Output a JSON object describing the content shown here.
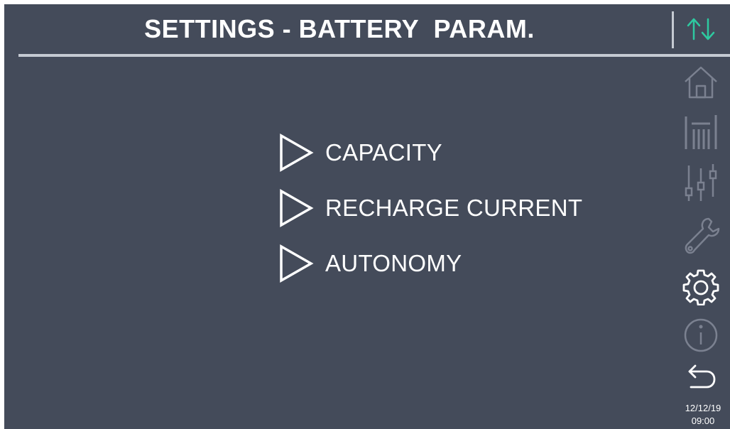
{
  "header": {
    "title": "SETTINGS - BATTERY  PARAM."
  },
  "menu": {
    "items": [
      {
        "label": "CAPACITY"
      },
      {
        "label": "RECHARGE CURRENT"
      },
      {
        "label": "AUTONOMY"
      }
    ]
  },
  "sidebar": {
    "icons": [
      "up-down-arrows-icon",
      "home-icon",
      "measurements-icon",
      "sliders-icon",
      "wrench-icon",
      "gear-icon",
      "info-icon",
      "back-icon"
    ],
    "active": "gear-icon"
  },
  "status": {
    "date": "12/12/19",
    "time": "09:00"
  },
  "colors": {
    "background": "#444b5a",
    "accent": "#2ec9a0",
    "active_icon": "#ffffff",
    "inactive_icon": "#7b8190"
  }
}
